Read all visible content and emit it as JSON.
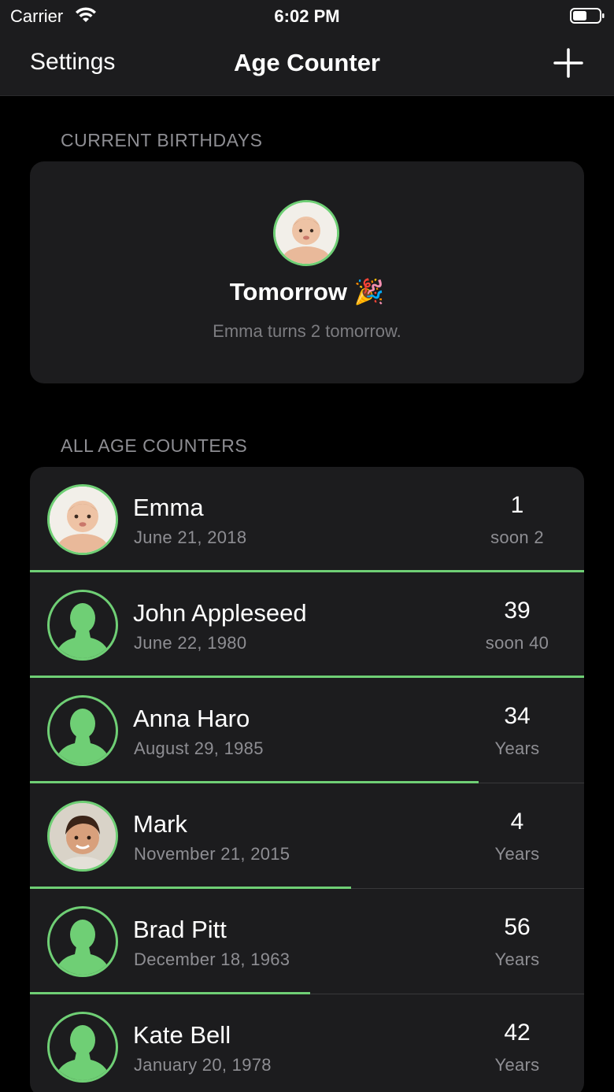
{
  "status_bar": {
    "carrier": "Carrier",
    "time": "6:02 PM"
  },
  "nav": {
    "left_label": "Settings",
    "title": "Age Counter",
    "right_icon": "plus-icon"
  },
  "current_section": {
    "header": "CURRENT BIRTHDAYS",
    "title": "Tomorrow 🎉",
    "subtitle": "Emma turns 2 tomorrow."
  },
  "list_section": {
    "header": "ALL AGE COUNTERS",
    "rows": [
      {
        "name": "Emma",
        "date": "June 21, 2018",
        "age": "1",
        "age_sub": "soon 2",
        "avatar": "baby-photo",
        "progress": 1.0
      },
      {
        "name": "John Appleseed",
        "date": "June 22, 1980",
        "age": "39",
        "age_sub": "soon 40",
        "avatar": "person-placeholder-icon",
        "progress": 1.0
      },
      {
        "name": "Anna Haro",
        "date": "August 29, 1985",
        "age": "34",
        "age_sub": "Years",
        "avatar": "person-placeholder-icon",
        "progress": 0.81
      },
      {
        "name": "Mark",
        "date": "November 21, 2015",
        "age": "4",
        "age_sub": "Years",
        "avatar": "boy-photo",
        "progress": 0.58
      },
      {
        "name": "Brad Pitt",
        "date": "December 18, 1963",
        "age": "56",
        "age_sub": "Years",
        "avatar": "person-placeholder-icon",
        "progress": 0.505
      },
      {
        "name": "Kate Bell",
        "date": "January 20, 1978",
        "age": "42",
        "age_sub": "Years",
        "avatar": "person-placeholder-icon",
        "progress": 0
      }
    ]
  },
  "colors": {
    "accent": "#6fcf75",
    "card_bg": "#1c1c1e",
    "background": "#000000",
    "secondary_text": "#8e8e93"
  }
}
